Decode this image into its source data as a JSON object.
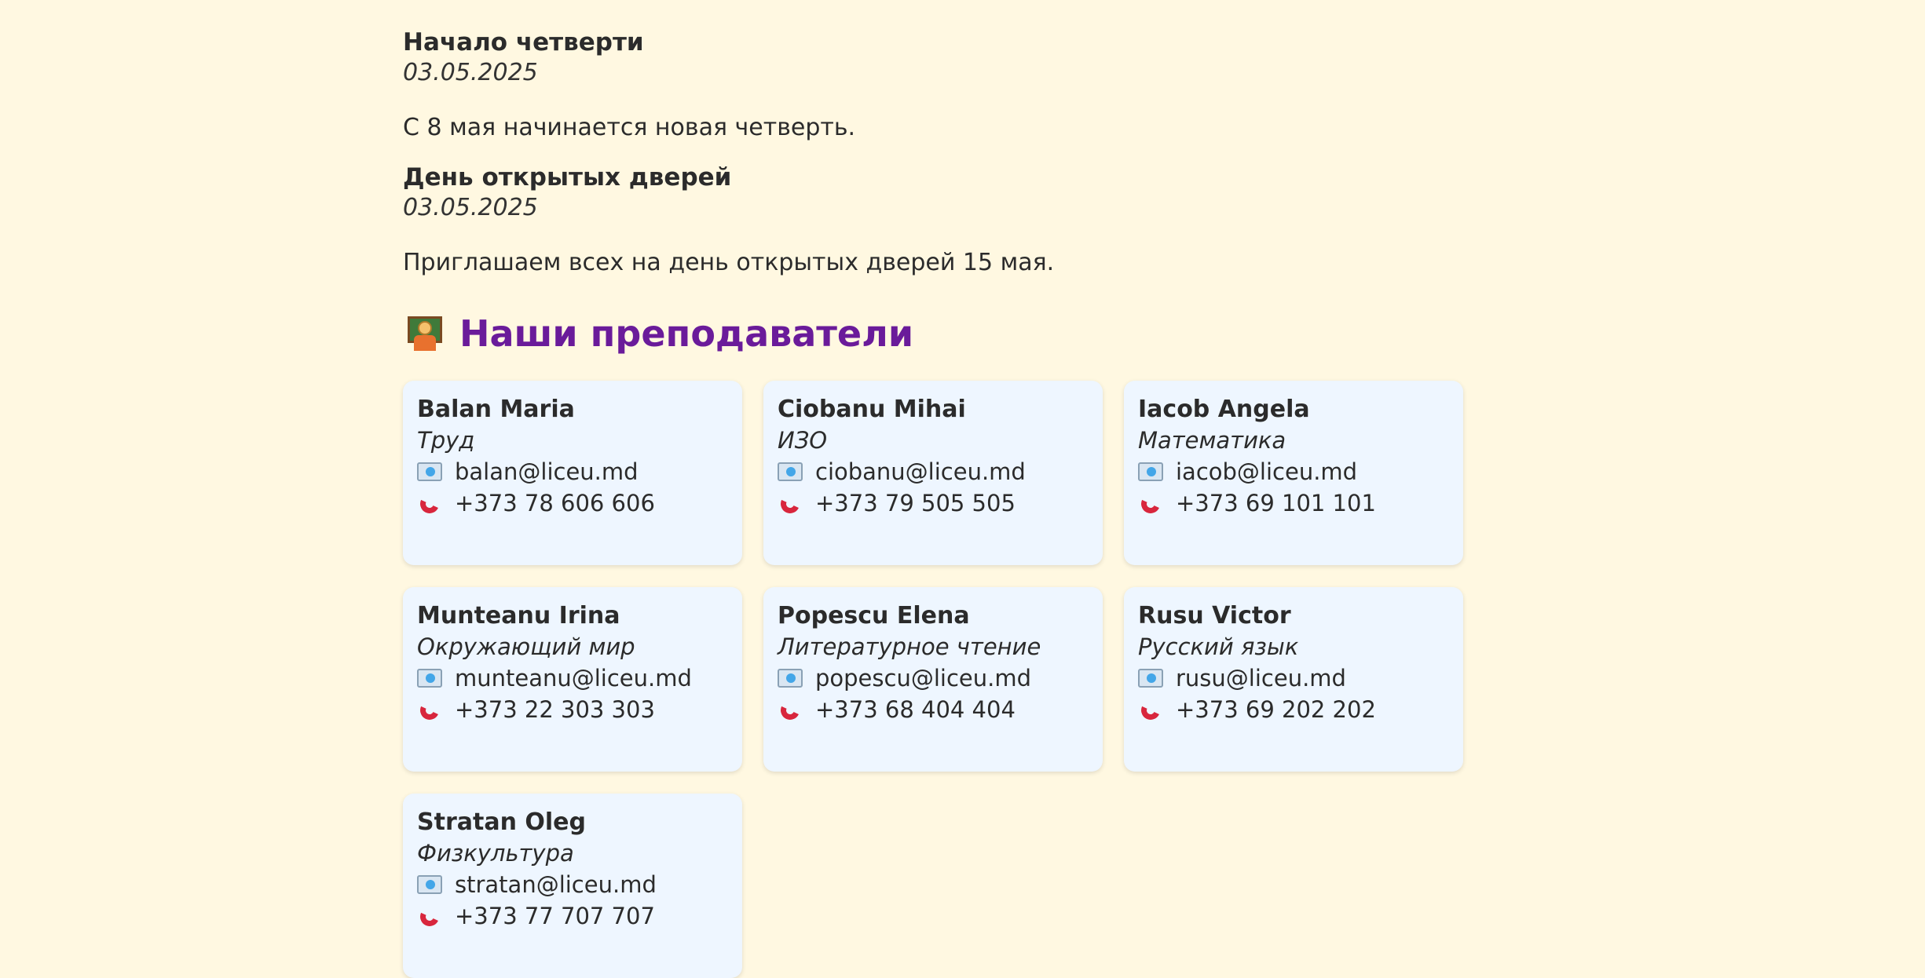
{
  "news": [
    {
      "title": "Начало четверти",
      "date": "03.05.2025",
      "text": "С 8 мая начинается новая четверть."
    },
    {
      "title": "День открытых дверей",
      "date": "03.05.2025",
      "text": "Приглашаем всех на день открытых дверей 15 мая."
    }
  ],
  "teachers_section": {
    "icon": "teacher-emoji-icon",
    "title": "Наши преподаватели"
  },
  "teachers": [
    {
      "name": "Balan Maria",
      "subject": "Труд",
      "email": "balan@liceu.md",
      "phone": "+373 78 606 606"
    },
    {
      "name": "Ciobanu Mihai",
      "subject": "ИЗО",
      "email": "ciobanu@liceu.md",
      "phone": "+373 79 505 505"
    },
    {
      "name": "Iacob Angela",
      "subject": "Математика",
      "email": "iacob@liceu.md",
      "phone": "+373 69 101 101"
    },
    {
      "name": "Munteanu Irina",
      "subject": "Окружающий мир",
      "email": "munteanu@liceu.md",
      "phone": "+373 22 303 303"
    },
    {
      "name": "Popescu Elena",
      "subject": "Литературное чтение",
      "email": "popescu@liceu.md",
      "phone": "+373 68 404 404"
    },
    {
      "name": "Rusu Victor",
      "subject": "Русский язык",
      "email": "rusu@liceu.md",
      "phone": "+373 69 202 202"
    },
    {
      "name": "Stratan Oleg",
      "subject": "Физкультура",
      "email": "stratan@liceu.md",
      "phone": "+373 77 707 707"
    }
  ],
  "colors": {
    "background": "#fff8e1",
    "card": "#eef6ff",
    "heading": "#6a1b9a"
  }
}
